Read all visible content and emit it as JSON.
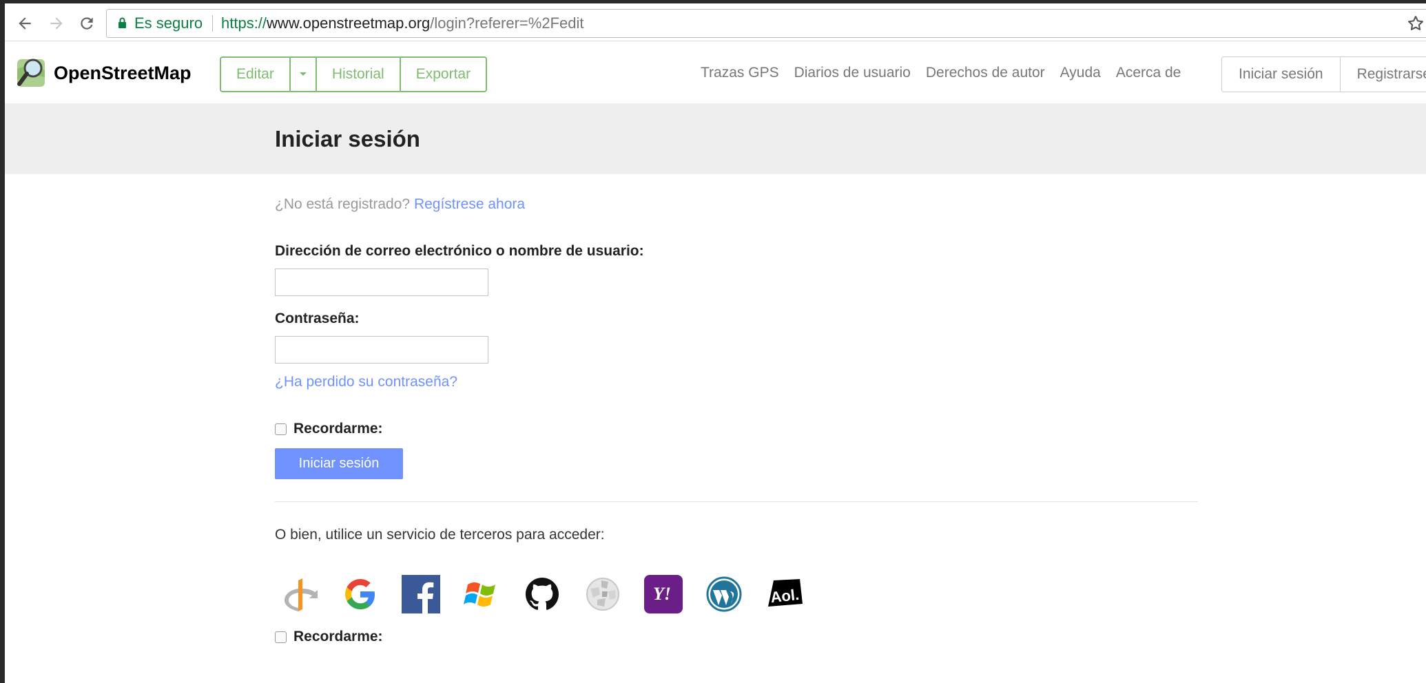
{
  "browser": {
    "secure_label": "Es seguro",
    "url_scheme": "https://",
    "url_host": "www.openstreetmap.org",
    "url_path": "/login?referer=%2Fedit"
  },
  "header": {
    "brand": "OpenStreetMap",
    "edit_label": "Editar",
    "history_label": "Historial",
    "export_label": "Exportar",
    "nav": [
      "Trazas GPS",
      "Diarios de usuario",
      "Derechos de autor",
      "Ayuda",
      "Acerca de"
    ],
    "login_label": "Iniciar sesión",
    "signup_label": "Registrarse"
  },
  "page": {
    "title": "Iniciar sesión",
    "not_registered": "¿No está registrado?",
    "register_now": "Regístrese ahora",
    "username_label": "Dirección de correo electrónico o nombre de usuario:",
    "username_value": "",
    "password_label": "Contraseña:",
    "password_value": "",
    "lost_password": "¿Ha perdido su contraseña?",
    "remember_label": "Recordarme:",
    "login_button": "Iniciar sesión",
    "third_party_text": "O bien, utilice un servicio de terceros para acceder:",
    "remember_label_2": "Recordarme:",
    "providers": [
      "openid-icon",
      "google-icon",
      "facebook-icon",
      "windows-live-icon",
      "github-icon",
      "wikipedia-icon",
      "yahoo-icon",
      "wordpress-icon",
      "aol-icon"
    ]
  },
  "colors": {
    "accent_green": "#7ebc6f",
    "link_blue": "#7092ff",
    "secure_green": "#0b8043"
  }
}
